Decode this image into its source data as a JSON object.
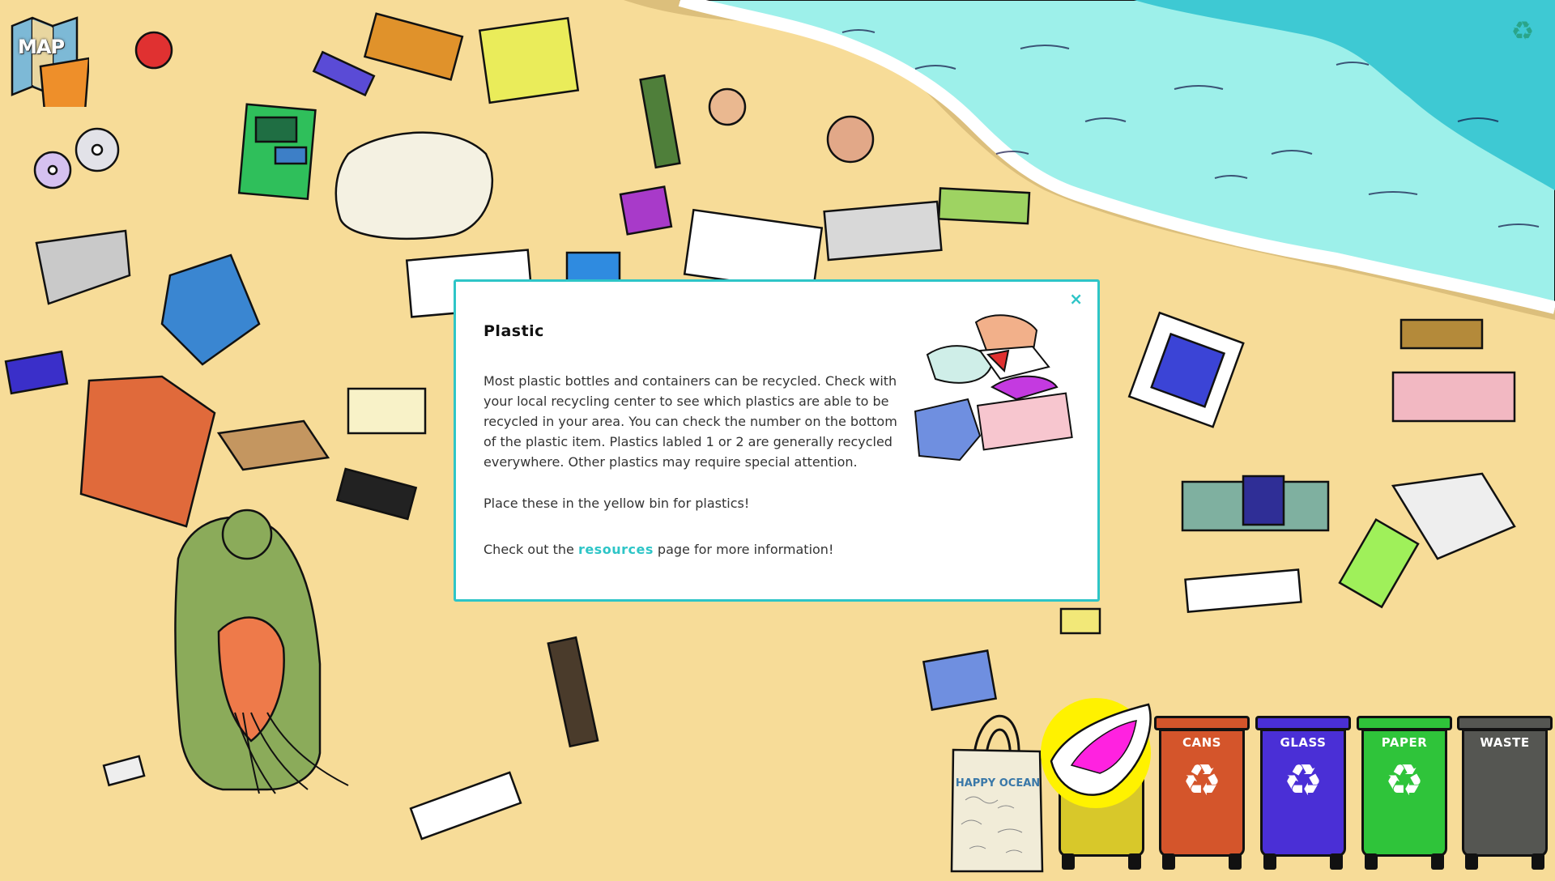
{
  "hud": {
    "map_label": "MAP",
    "recycle_icon": "recycle-icon"
  },
  "modal": {
    "title": "Plastic",
    "description": "Most plastic bottles and containers can be recycled. Check with your local recycling center to see which plastics are able to be recycled in your area. You can check the number on the bottom of the plastic item. Plastics labled 1 or 2 are generally recycled everywhere. Other plastics may require special attention.",
    "place_text": "Place these in the yellow bin for plastics!",
    "more_prefix": "Check out the ",
    "more_link": "resources",
    "more_suffix": " page for more information!",
    "close_label": "×",
    "accent_color": "#2ec5c7"
  },
  "tote": {
    "label": "HAPPY OCEAN"
  },
  "bins": [
    {
      "id": "plastic",
      "label": "",
      "color": "#d8c82a"
    },
    {
      "id": "cans",
      "label": "CANS",
      "color": "#d4552b"
    },
    {
      "id": "glass",
      "label": "GLASS",
      "color": "#4a2fd6"
    },
    {
      "id": "paper",
      "label": "PAPER",
      "color": "#2fc43a"
    },
    {
      "id": "waste",
      "label": "WASTE",
      "color": "#555652"
    }
  ],
  "colors": {
    "sand": "#f7dc98",
    "wet_sand": "#dcbf7c",
    "sea_light": "#9df0ea",
    "sea_dark": "#3ec9d3",
    "highlight": "#fff200"
  }
}
